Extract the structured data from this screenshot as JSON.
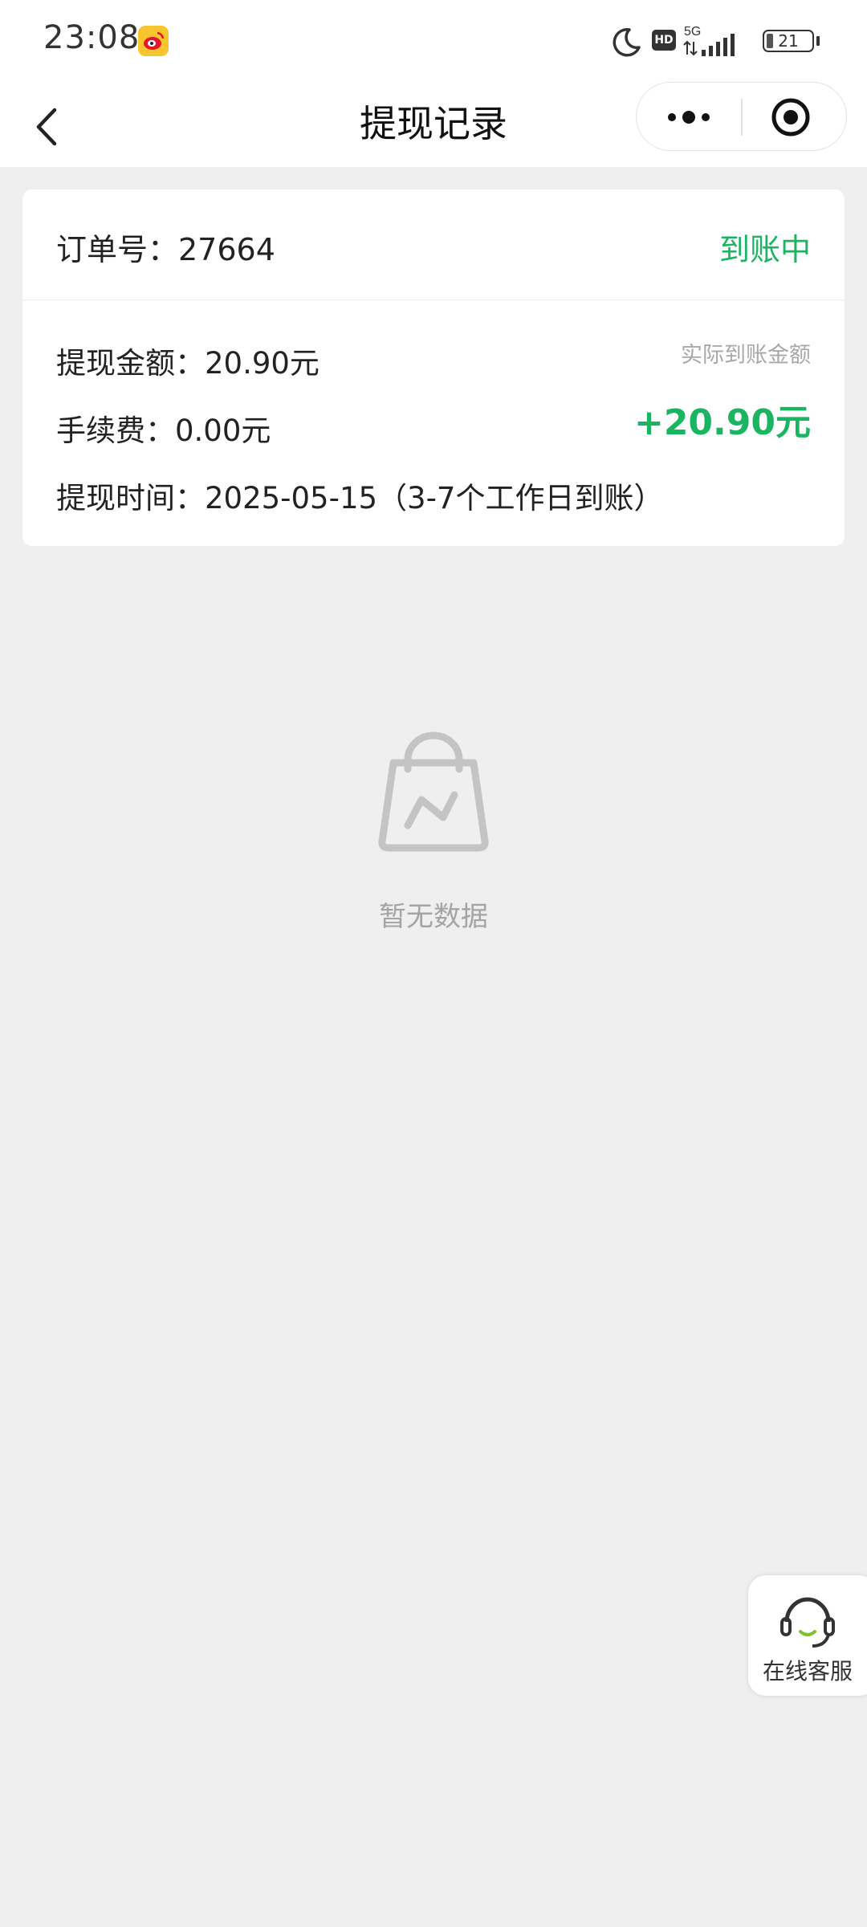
{
  "status_bar": {
    "time": "23:08",
    "network": "5G",
    "hd": "HD",
    "battery": "21"
  },
  "nav": {
    "title": "提现记录"
  },
  "order": {
    "order_no": "订单号：27664",
    "status": "到账中",
    "amount_line": "提现金额：20.90元",
    "fee_line": "手续费：0.00元",
    "time_line": "提现时间：2025-05-15（3-7个工作日到账）",
    "actual_label": "实际到账金额",
    "actual_amount": "+20.90元"
  },
  "empty_state": {
    "text": "暂无数据"
  },
  "service": {
    "label": "在线客服"
  },
  "colors": {
    "accent_green": "#19b560",
    "background": "#efefef"
  },
  "icons": [
    "weibo-icon",
    "moon-icon",
    "signal-icon",
    "battery-icon",
    "back-icon",
    "more-icon",
    "close-target-icon",
    "empty-bag-icon",
    "headset-icon"
  ]
}
